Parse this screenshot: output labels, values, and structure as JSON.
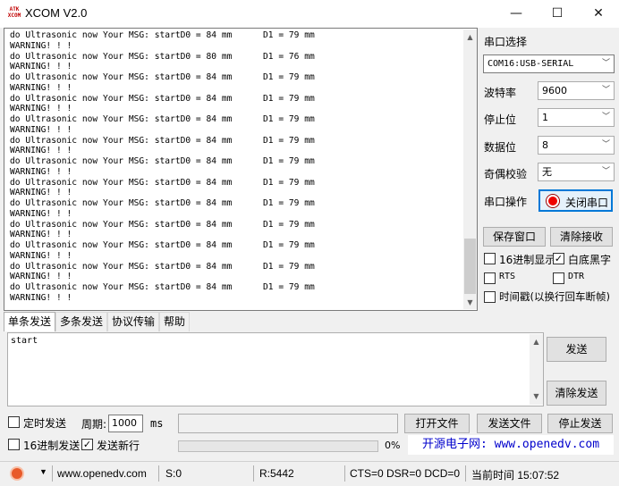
{
  "window": {
    "title": "XCOM V2.0",
    "logo_text_top": "ATK",
    "logo_text_bottom": "XCOM",
    "minimize_glyph": "—",
    "maximize_glyph": "☐",
    "close_glyph": "✕"
  },
  "receive": {
    "lines": [
      "do Ultrasonic now Your MSG: startD0 = 84 mm      D1 = 79 mm",
      "WARNING! ! !",
      "do Ultrasonic now Your MSG: startD0 = 80 mm      D1 = 76 mm",
      "WARNING! ! !",
      "do Ultrasonic now Your MSG: startD0 = 84 mm      D1 = 79 mm",
      "WARNING! ! !",
      "do Ultrasonic now Your MSG: startD0 = 84 mm      D1 = 79 mm",
      "WARNING! ! !",
      "do Ultrasonic now Your MSG: startD0 = 84 mm      D1 = 79 mm",
      "WARNING! ! !",
      "do Ultrasonic now Your MSG: startD0 = 84 mm      D1 = 79 mm",
      "WARNING! ! !",
      "do Ultrasonic now Your MSG: startD0 = 84 mm      D1 = 79 mm",
      "WARNING! ! !",
      "do Ultrasonic now Your MSG: startD0 = 84 mm      D1 = 79 mm",
      "WARNING! ! !",
      "do Ultrasonic now Your MSG: startD0 = 84 mm      D1 = 79 mm",
      "WARNING! ! !",
      "do Ultrasonic now Your MSG: startD0 = 84 mm      D1 = 79 mm",
      "WARNING! ! !",
      "do Ultrasonic now Your MSG: startD0 = 84 mm      D1 = 79 mm",
      "WARNING! ! !",
      "do Ultrasonic now Your MSG: startD0 = 84 mm      D1 = 79 mm",
      "WARNING! ! !",
      "do Ultrasonic now Your MSG: startD0 = 84 mm      D1 = 79 mm",
      "WARNING! ! !"
    ]
  },
  "settings": {
    "port_label": "串口选择",
    "port_value": "COM16:USB-SERIAL",
    "baud_label": "波特率",
    "baud_value": "9600",
    "stopbits_label": "停止位",
    "stopbits_value": "1",
    "databits_label": "数据位",
    "databits_value": "8",
    "parity_label": "奇偶校验",
    "parity_value": "无",
    "operation_label": "串口操作",
    "close_port_button": "关闭串口",
    "save_window_button": "保存窗口",
    "clear_receive_button": "清除接收",
    "hex_display_label": "16进制显示",
    "white_bg_label": "白底黑字",
    "rts_label": "RTS",
    "dtr_label": "DTR",
    "timestamp_label": "时间戳(以换行回车断帧)"
  },
  "tabs": [
    "单条发送",
    "多条发送",
    "协议传输",
    "帮助"
  ],
  "send": {
    "text": "start",
    "send_button": "发送",
    "clear_send_button": "清除发送",
    "timed_send_label": "定时发送",
    "period_label": "周期:",
    "period_value": "1000",
    "period_unit": "ms",
    "open_file_button": "打开文件",
    "send_file_button": "发送文件",
    "stop_send_button": "停止发送",
    "hex_send_label": "16进制发送",
    "send_newline_label": "发送新行",
    "progress_text": "0%",
    "website": "开源电子网: www.openedv.com"
  },
  "status": {
    "url": "www.openedv.com",
    "sent": "S:0",
    "received": "R:5442",
    "lines": "CTS=0 DSR=0 DCD=0",
    "time": "当前时间 15:07:52"
  }
}
